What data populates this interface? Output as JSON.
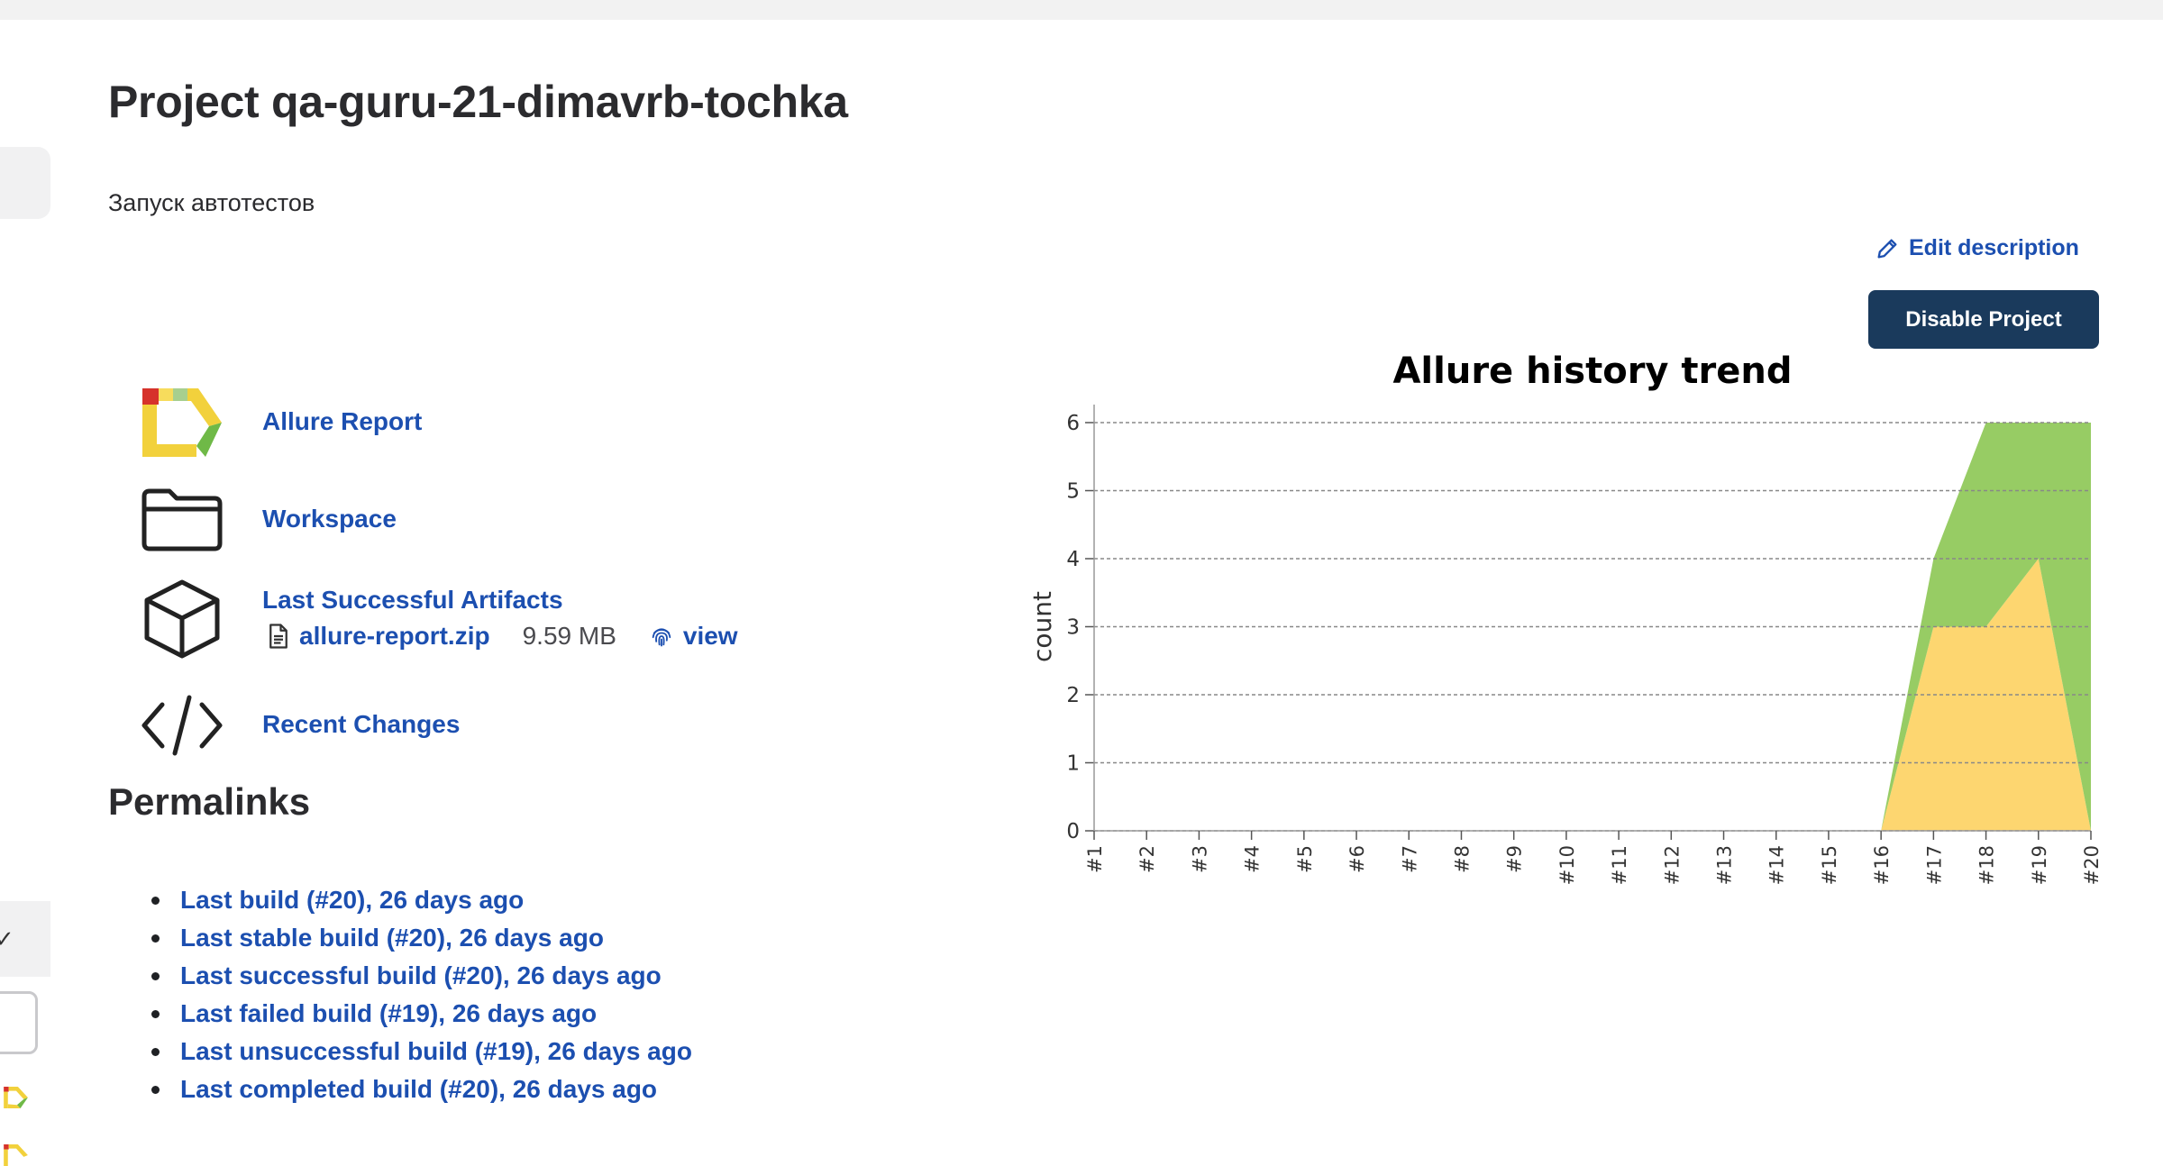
{
  "page": {
    "title": "Project qa-guru-21-dimavrb-tochka",
    "description": "Запуск автотестов",
    "edit_description": "Edit description",
    "disable_button": "Disable Project"
  },
  "tasks": [
    {
      "label": "Allure Report",
      "icon": "allure-icon"
    },
    {
      "label": "Workspace",
      "icon": "folder-icon"
    },
    {
      "label": "Last Successful Artifacts",
      "icon": "package-icon"
    },
    {
      "label": "Recent Changes",
      "icon": "code-icon"
    }
  ],
  "artifact": {
    "file": "allure-report.zip",
    "size": "9.59 MB",
    "view": "view"
  },
  "permalinks": {
    "title": "Permalinks",
    "items": [
      "Last build (#20), 26 days ago",
      "Last stable build (#20), 26 days ago",
      "Last successful build (#20), 26 days ago",
      "Last failed build (#19), 26 days ago",
      "Last unsuccessful build (#19), 26 days ago",
      "Last completed build (#20), 26 days ago"
    ]
  },
  "colors": {
    "link": "#1c4fb0",
    "button_bg": "#1a3a5c",
    "passed": "#97cc64",
    "broken": "#fdd670"
  },
  "chart_data": {
    "type": "area",
    "title": "Allure history trend",
    "ylabel": "count",
    "xlabel": "",
    "categories": [
      "#1",
      "#2",
      "#3",
      "#4",
      "#5",
      "#6",
      "#7",
      "#8",
      "#9",
      "#10",
      "#11",
      "#12",
      "#13",
      "#14",
      "#15",
      "#16",
      "#17",
      "#18",
      "#19",
      "#20"
    ],
    "ylim": [
      0,
      6
    ],
    "yticks": [
      0,
      1,
      2,
      3,
      4,
      5,
      6
    ],
    "grid": true,
    "stacked": true,
    "series": [
      {
        "color": "#fdd670",
        "values": [
          0,
          0,
          0,
          0,
          0,
          0,
          0,
          0,
          0,
          0,
          0,
          0,
          0,
          0,
          0,
          0,
          3,
          3,
          4,
          0
        ]
      },
      {
        "color": "#97cc64",
        "values": [
          0,
          0,
          0,
          0,
          0,
          0,
          0,
          0,
          0,
          0,
          0,
          0,
          0,
          0,
          0,
          0,
          1,
          3,
          2,
          6
        ]
      }
    ]
  }
}
